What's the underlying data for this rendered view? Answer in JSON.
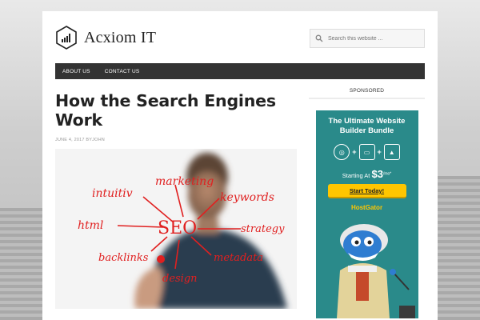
{
  "site": {
    "name": "Acxiom IT",
    "logo_icon": "bar-chart-hexagon-icon"
  },
  "search": {
    "placeholder": "Search this website ...",
    "icon": "search-icon"
  },
  "nav": {
    "items": [
      {
        "label": "ABOUT US"
      },
      {
        "label": "CONTACT US"
      }
    ]
  },
  "post": {
    "title": "How the Search Engines Work",
    "date": "JUNE 4, 2017",
    "by": "BY",
    "author": "JOHN",
    "image": {
      "words": [
        "intuitiv",
        "marketing",
        "keywords",
        "html",
        "SEO",
        "strategy",
        "backlinks",
        "metadata",
        "design"
      ]
    }
  },
  "sidebar": {
    "widget_title": "SPONSORED",
    "ad": {
      "title": "The Ultimate Website Builder Bundle",
      "price_prefix": "Starting At ",
      "price": "$3",
      "price_suffix": "/mo*",
      "cta": "Start Today!",
      "brand": "HostGator",
      "background": "#2a8a8a",
      "cta_color": "#ffc600"
    }
  }
}
